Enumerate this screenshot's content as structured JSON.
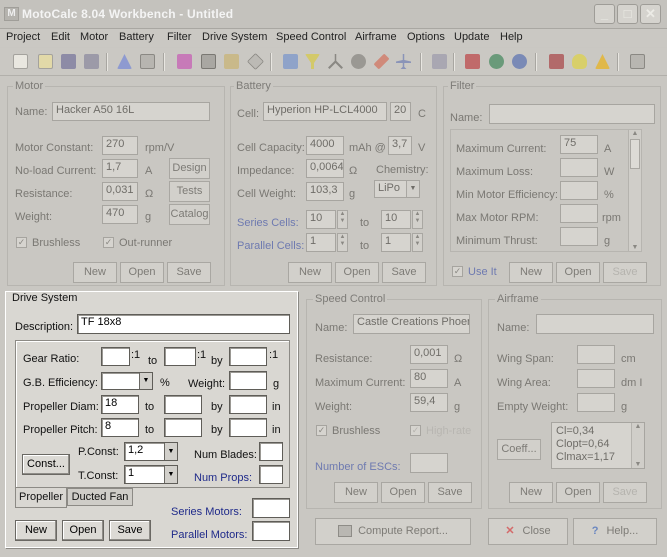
{
  "window": {
    "title": "MotoCalc 8.04 Workbench - Untitled"
  },
  "menu": [
    "Project",
    "Edit",
    "Motor",
    "Battery",
    "Filter",
    "Drive System",
    "Speed Control",
    "Airframe",
    "Options",
    "Update",
    "Help"
  ],
  "motor": {
    "group": "Motor",
    "name_label": "Name:",
    "name": "Hacker A50 16L",
    "constant_label": "Motor Constant:",
    "constant": "270",
    "constant_unit": "rpm/V",
    "noload_label": "No-load Current:",
    "noload": "1,7",
    "noload_unit": "A",
    "resistance_label": "Resistance:",
    "resistance": "0,031",
    "resistance_unit": "Ω",
    "weight_label": "Weight:",
    "weight": "470",
    "weight_unit": "g",
    "design_btn": "Design",
    "tests_btn": "Tests",
    "catalog_btn": "Catalog",
    "brushless_label": "Brushless",
    "outrunner_label": "Out-runner",
    "new_btn": "New",
    "open_btn": "Open",
    "save_btn": "Save"
  },
  "battery": {
    "group": "Battery",
    "cell_label": "Cell:",
    "cell": "Hyperion HP-LCL4000",
    "cell_count": "20",
    "cell_count_unit": "C",
    "capacity_label": "Cell Capacity:",
    "capacity": "4000",
    "capacity_unit": "mAh @",
    "voltage": "3,7",
    "voltage_unit": "V",
    "impedance_label": "Impedance:",
    "impedance": "0,0064",
    "impedance_unit": "Ω",
    "chemistry_label": "Chemistry:",
    "chemistry": "LiPo",
    "weight_label": "Cell Weight:",
    "weight": "103,3",
    "weight_unit": "g",
    "series_label": "Series Cells:",
    "series_from": "10",
    "to": "to",
    "series_to": "10",
    "parallel_label": "Parallel Cells:",
    "parallel_from": "1",
    "parallel_to": "1",
    "new_btn": "New",
    "open_btn": "Open",
    "save_btn": "Save"
  },
  "filter": {
    "group": "Filter",
    "name_label": "Name:",
    "name": "",
    "rows": [
      {
        "label": "Maximum Current:",
        "value": "75",
        "unit": "A"
      },
      {
        "label": "Maximum Loss:",
        "value": "",
        "unit": "W"
      },
      {
        "label": "Min Motor Efficiency:",
        "value": "",
        "unit": "%"
      },
      {
        "label": "Max Motor RPM:",
        "value": "",
        "unit": "rpm"
      },
      {
        "label": "Minimum Thrust:",
        "value": "",
        "unit": "g"
      }
    ],
    "use_it_label": "Use It",
    "new_btn": "New",
    "open_btn": "Open",
    "save_btn": "Save"
  },
  "drive": {
    "group": "Drive System",
    "desc_label": "Description:",
    "desc": "TF 18x8",
    "gear_label": "Gear Ratio:",
    "gear_a": "",
    "gear_b": "",
    "gear_c": "",
    "ratio_sep": ":1",
    "to": "to",
    "by": "by",
    "gbe_label": "G.B. Efficiency:",
    "gbe": "",
    "percent": "%",
    "weight_label": "Weight:",
    "weight": "",
    "g": "g",
    "diam_label": "Propeller Diam:",
    "diam_a": "18",
    "diam_b": "",
    "diam_c": "",
    "in": "in",
    "pitch_label": "Propeller Pitch:",
    "pitch_a": "8",
    "pitch_b": "",
    "pitch_c": "",
    "const_btn": "Const...",
    "pconst_label": "P.Const:",
    "pconst": "1,2",
    "tconst_label": "T.Const:",
    "tconst": "1",
    "blades_label": "Num Blades:",
    "blades": "",
    "props_label": "Num Props:",
    "props": "",
    "tab_propeller": "Propeller",
    "tab_ductedfan": "Ducted Fan",
    "series_motors_label": "Series Motors:",
    "series_motors": "",
    "parallel_motors_label": "Parallel Motors:",
    "parallel_motors": "",
    "new_btn": "New",
    "open_btn": "Open",
    "save_btn": "Save"
  },
  "speed": {
    "group": "Speed Control",
    "name_label": "Name:",
    "name": "Castle Creations Phoeni",
    "resistance_label": "Resistance:",
    "resistance": "0,001",
    "resistance_unit": "Ω",
    "maxcur_label": "Maximum Current:",
    "maxcur": "80",
    "maxcur_unit": "A",
    "weight_label": "Weight:",
    "weight": "59,4",
    "weight_unit": "g",
    "brushless_label": "Brushless",
    "highrate_label": "High-rate",
    "numesc_label": "Number of ESCs:",
    "numesc": "",
    "new_btn": "New",
    "open_btn": "Open",
    "save_btn": "Save"
  },
  "airframe": {
    "group": "Airframe",
    "name_label": "Name:",
    "name": "",
    "span_label": "Wing Span:",
    "span": "",
    "span_unit": "cm",
    "area_label": "Wing Area:",
    "area": "",
    "area_unit": "dm I",
    "empty_label": "Empty Weight:",
    "empty": "",
    "empty_unit": "g",
    "coeff_btn": "Coeff...",
    "coeffs": [
      "Cl=0,34",
      "Clopt=0,64",
      "Clmax=1,17"
    ],
    "new_btn": "New",
    "open_btn": "Open",
    "save_btn": "Save"
  },
  "bottom": {
    "compute": "Compute Report...",
    "close": "Close",
    "help": "Help..."
  }
}
